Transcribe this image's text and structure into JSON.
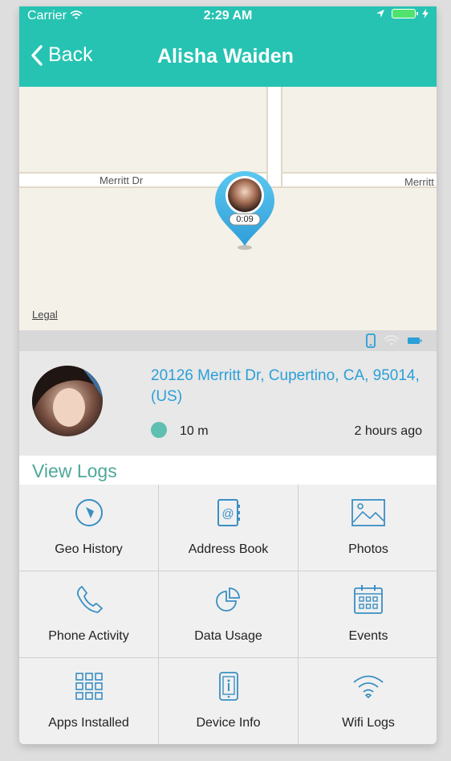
{
  "status_bar": {
    "carrier": "Carrier",
    "time": "2:29 AM"
  },
  "nav": {
    "back_label": "Back",
    "title": "Alisha Waiden"
  },
  "map": {
    "street_left": "Merritt Dr",
    "street_right": "Merritt",
    "pin_timer": "0:09",
    "legal_label": "Legal"
  },
  "profile": {
    "address": "20126 Merritt Dr, Cupertino, CA, 95014, (US)",
    "distance": "10 m",
    "last_seen": "2 hours ago"
  },
  "logs": {
    "title": "View Logs",
    "items": [
      {
        "label": "Geo History",
        "icon": "compass-icon"
      },
      {
        "label": "Address Book",
        "icon": "address-book-icon"
      },
      {
        "label": "Photos",
        "icon": "photo-icon"
      },
      {
        "label": "Phone Activity",
        "icon": "phone-icon"
      },
      {
        "label": "Data Usage",
        "icon": "pie-chart-icon"
      },
      {
        "label": "Events",
        "icon": "calendar-icon"
      },
      {
        "label": "Apps Installed",
        "icon": "apps-grid-icon"
      },
      {
        "label": "Device Info",
        "icon": "device-info-icon"
      },
      {
        "label": "Wifi Logs",
        "icon": "wifi-icon"
      }
    ]
  },
  "colors": {
    "accent": "#26c3b2",
    "icon": "#3a8fc4",
    "link": "#2b9fd8",
    "section_title": "#4ea89a"
  }
}
